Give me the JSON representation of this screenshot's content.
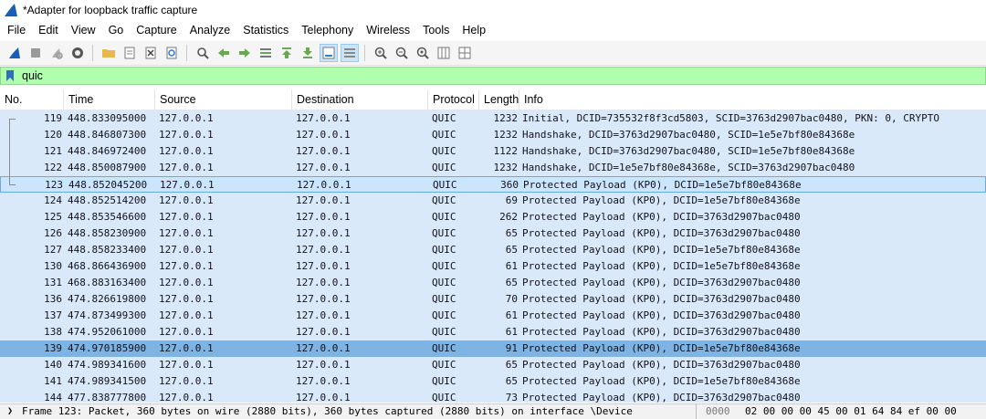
{
  "window": {
    "title": "*Adapter for loopback traffic capture",
    "icon": "wireshark-fin-icon"
  },
  "menu": [
    "File",
    "Edit",
    "View",
    "Go",
    "Capture",
    "Analyze",
    "Statistics",
    "Telephony",
    "Wireless",
    "Tools",
    "Help"
  ],
  "toolbar": {
    "icons": [
      "start-capture-icon",
      "stop-capture-icon",
      "restart-capture-icon",
      "capture-options-icon",
      "open-file-icon",
      "save-file-icon",
      "close-file-icon",
      "reload-file-icon",
      "find-packet-icon",
      "go-back-icon",
      "go-forward-icon",
      "go-to-packet-icon",
      "go-first-icon",
      "go-last-icon",
      "autoscroll-icon",
      "colorize-icon",
      "zoom-in-icon",
      "zoom-out-icon",
      "zoom-normal-icon",
      "resize-columns-icon",
      "grid-icon"
    ]
  },
  "filter": {
    "value": "quic",
    "bg_color": "#afffaf"
  },
  "columns": {
    "no": "No.",
    "time": "Time",
    "source": "Source",
    "destination": "Destination",
    "protocol": "Protocol",
    "length": "Length",
    "info": "Info"
  },
  "packets": [
    {
      "no": "119",
      "time": "448.833095000",
      "src": "127.0.0.1",
      "dst": "127.0.0.1",
      "proto": "QUIC",
      "len": "1232",
      "info": "Initial, DCID=735532f8f3cd5803, SCID=3763d2907bac0480, PKN: 0, CRYPTO"
    },
    {
      "no": "120",
      "time": "448.846807300",
      "src": "127.0.0.1",
      "dst": "127.0.0.1",
      "proto": "QUIC",
      "len": "1232",
      "info": "Handshake, DCID=3763d2907bac0480, SCID=1e5e7bf80e84368e"
    },
    {
      "no": "121",
      "time": "448.846972400",
      "src": "127.0.0.1",
      "dst": "127.0.0.1",
      "proto": "QUIC",
      "len": "1122",
      "info": "Handshake, DCID=3763d2907bac0480, SCID=1e5e7bf80e84368e"
    },
    {
      "no": "122",
      "time": "448.850087900",
      "src": "127.0.0.1",
      "dst": "127.0.0.1",
      "proto": "QUIC",
      "len": "1232",
      "info": "Handshake, DCID=1e5e7bf80e84368e, SCID=3763d2907bac0480"
    },
    {
      "no": "123",
      "time": "448.852045200",
      "src": "127.0.0.1",
      "dst": "127.0.0.1",
      "proto": "QUIC",
      "len": "360",
      "info": "Protected Payload (KP0), DCID=1e5e7bf80e84368e"
    },
    {
      "no": "124",
      "time": "448.852514200",
      "src": "127.0.0.1",
      "dst": "127.0.0.1",
      "proto": "QUIC",
      "len": "69",
      "info": "Protected Payload (KP0), DCID=1e5e7bf80e84368e"
    },
    {
      "no": "125",
      "time": "448.853546600",
      "src": "127.0.0.1",
      "dst": "127.0.0.1",
      "proto": "QUIC",
      "len": "262",
      "info": "Protected Payload (KP0), DCID=3763d2907bac0480"
    },
    {
      "no": "126",
      "time": "448.858230900",
      "src": "127.0.0.1",
      "dst": "127.0.0.1",
      "proto": "QUIC",
      "len": "65",
      "info": "Protected Payload (KP0), DCID=3763d2907bac0480"
    },
    {
      "no": "127",
      "time": "448.858233400",
      "src": "127.0.0.1",
      "dst": "127.0.0.1",
      "proto": "QUIC",
      "len": "65",
      "info": "Protected Payload (KP0), DCID=1e5e7bf80e84368e"
    },
    {
      "no": "130",
      "time": "468.866436900",
      "src": "127.0.0.1",
      "dst": "127.0.0.1",
      "proto": "QUIC",
      "len": "61",
      "info": "Protected Payload (KP0), DCID=1e5e7bf80e84368e"
    },
    {
      "no": "131",
      "time": "468.883163400",
      "src": "127.0.0.1",
      "dst": "127.0.0.1",
      "proto": "QUIC",
      "len": "65",
      "info": "Protected Payload (KP0), DCID=3763d2907bac0480"
    },
    {
      "no": "136",
      "time": "474.826619800",
      "src": "127.0.0.1",
      "dst": "127.0.0.1",
      "proto": "QUIC",
      "len": "70",
      "info": "Protected Payload (KP0), DCID=3763d2907bac0480"
    },
    {
      "no": "137",
      "time": "474.873499300",
      "src": "127.0.0.1",
      "dst": "127.0.0.1",
      "proto": "QUIC",
      "len": "61",
      "info": "Protected Payload (KP0), DCID=3763d2907bac0480"
    },
    {
      "no": "138",
      "time": "474.952061000",
      "src": "127.0.0.1",
      "dst": "127.0.0.1",
      "proto": "QUIC",
      "len": "61",
      "info": "Protected Payload (KP0), DCID=3763d2907bac0480"
    },
    {
      "no": "139",
      "time": "474.970185900",
      "src": "127.0.0.1",
      "dst": "127.0.0.1",
      "proto": "QUIC",
      "len": "91",
      "info": "Protected Payload (KP0), DCID=1e5e7bf80e84368e"
    },
    {
      "no": "140",
      "time": "474.989341600",
      "src": "127.0.0.1",
      "dst": "127.0.0.1",
      "proto": "QUIC",
      "len": "65",
      "info": "Protected Payload (KP0), DCID=3763d2907bac0480"
    },
    {
      "no": "141",
      "time": "474.989341500",
      "src": "127.0.0.1",
      "dst": "127.0.0.1",
      "proto": "QUIC",
      "len": "65",
      "info": "Protected Payload (KP0), DCID=1e5e7bf80e84368e"
    },
    {
      "no": "144",
      "time": "477.838777800",
      "src": "127.0.0.1",
      "dst": "127.0.0.1",
      "proto": "QUIC",
      "len": "73",
      "info": "Protected Payload (KP0), DCID=3763d2907bac0480"
    }
  ],
  "selected_packet": "123",
  "highlighted_packet": "139",
  "details": {
    "summary": "Frame 123: Packet, 360 bytes on wire (2880 bits), 360 bytes captured (2880 bits) on interface \\Device"
  },
  "hex": {
    "offset": "0000",
    "bytes": "02 00 00 00 45 00 01 64  84 ef 00 00"
  },
  "colors": {
    "row_bg": "#dae9fa",
    "selected_bg": "#cde5fb",
    "highlight_bg": "#7db4e4",
    "filter_bg": "#afffaf"
  }
}
